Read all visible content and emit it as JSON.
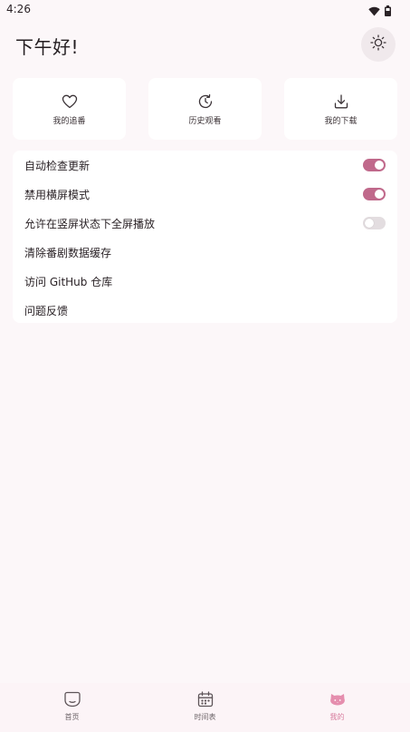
{
  "status_bar": {
    "time": "4:26",
    "icons": [
      "wifi-icon",
      "battery-icon"
    ]
  },
  "header": {
    "greeting": "下午好!",
    "theme_toggle_icon": "sun-icon"
  },
  "quick_actions": [
    {
      "label": "我的追番",
      "icon": "heart-icon"
    },
    {
      "label": "历史观看",
      "icon": "history-icon"
    },
    {
      "label": "我的下载",
      "icon": "download-icon"
    }
  ],
  "settings": [
    {
      "label": "自动检查更新",
      "toggle": true,
      "value": true
    },
    {
      "label": "禁用横屏模式",
      "toggle": true,
      "value": true
    },
    {
      "label": "允许在竖屏状态下全屏播放",
      "toggle": true,
      "value": false
    },
    {
      "label": "清除番剧数据缓存",
      "toggle": false
    },
    {
      "label": "访问 GitHub 仓库",
      "toggle": false
    },
    {
      "label": "问题反馈",
      "toggle": false
    }
  ],
  "bottom_nav": [
    {
      "label": "首页",
      "icon": "home-icon",
      "active": false
    },
    {
      "label": "时间表",
      "icon": "calendar-icon",
      "active": false
    },
    {
      "label": "我的",
      "icon": "cat-face-icon",
      "active": true
    }
  ],
  "colors": {
    "accent": "#c0698b",
    "nav_active": "#d77b9d",
    "background": "#fcf7f9",
    "card": "#ffffff"
  }
}
